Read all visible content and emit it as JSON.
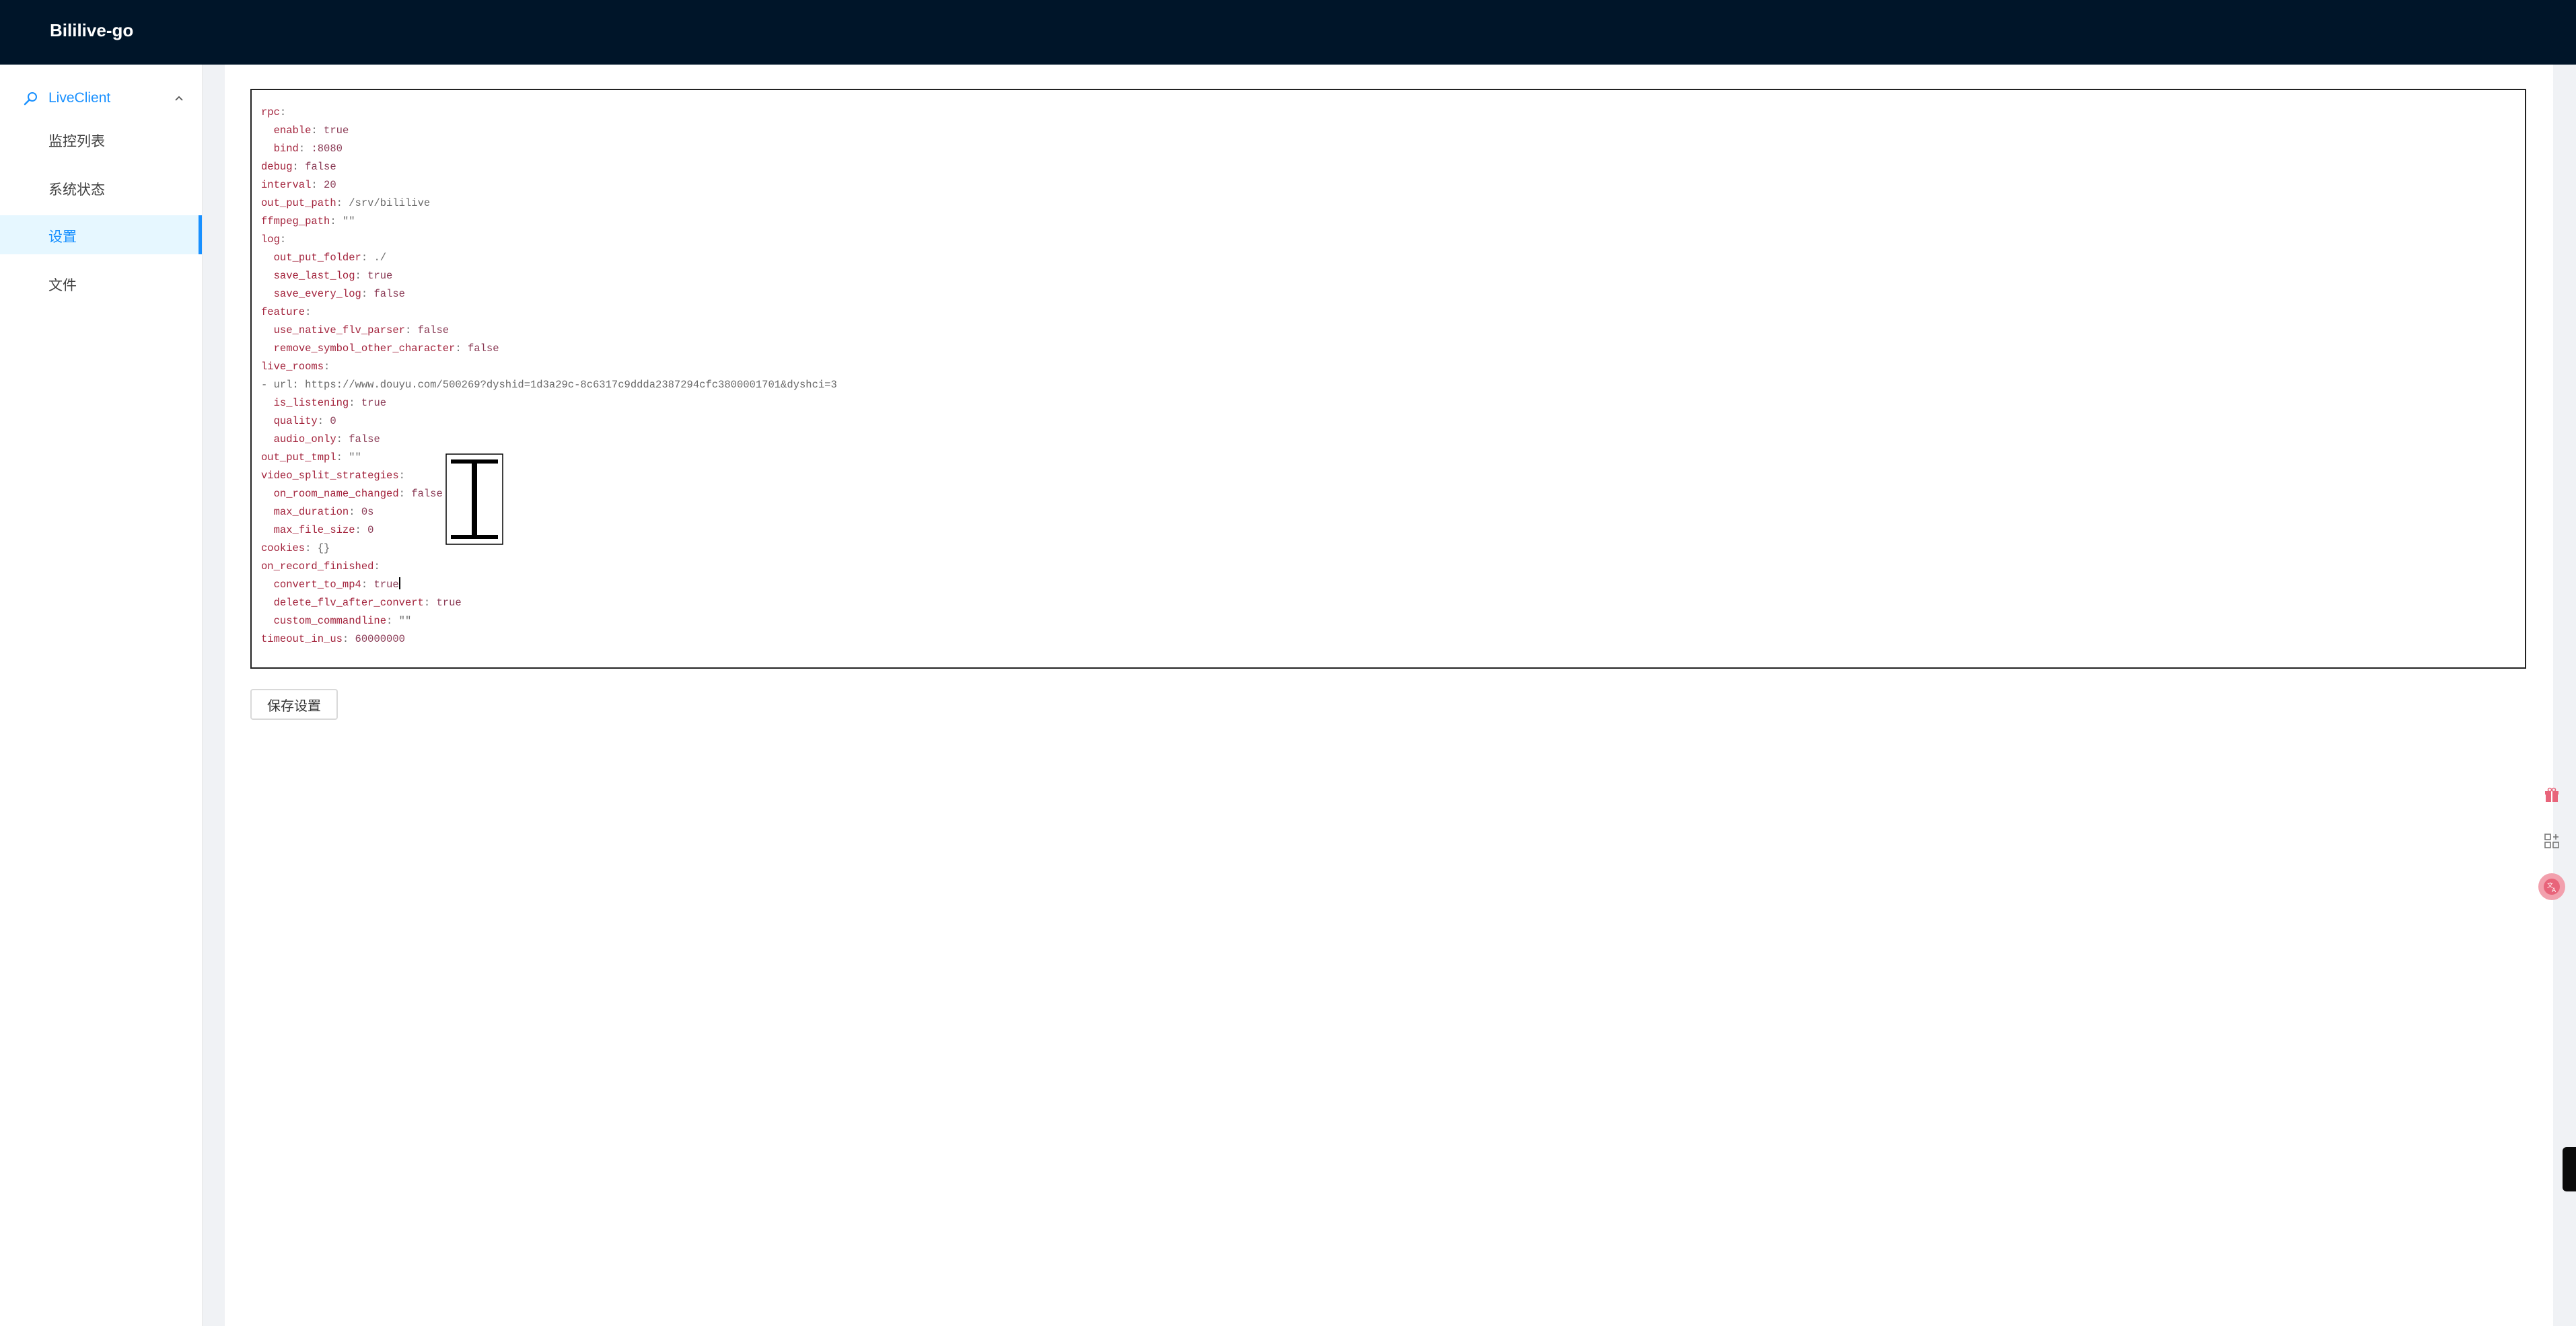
{
  "app": {
    "title": "Bililive-go"
  },
  "sidebar": {
    "group": {
      "label": "LiveClient",
      "icon": "search-icon",
      "chevron": "chevron-up-icon"
    },
    "items": [
      {
        "label": "监控列表",
        "active": false
      },
      {
        "label": "系统状态",
        "active": false
      },
      {
        "label": "设置",
        "active": true
      },
      {
        "label": "文件",
        "active": false
      }
    ]
  },
  "editor": {
    "lines": [
      {
        "indent": "",
        "key": "rpc",
        "value": "",
        "vclass": ""
      },
      {
        "indent": "  ",
        "key": "enable",
        "value": "true",
        "vclass": "v"
      },
      {
        "indent": "  ",
        "key": "bind",
        "value": ":8080",
        "vclass": "v"
      },
      {
        "indent": "",
        "key": "debug",
        "value": "false",
        "vclass": "v"
      },
      {
        "indent": "",
        "key": "interval",
        "value": "20",
        "vclass": "v"
      },
      {
        "indent": "",
        "key": "out_put_path",
        "value": "/srv/bililive",
        "vclass": "s"
      },
      {
        "indent": "",
        "key": "ffmpeg_path",
        "value": "\"\"",
        "vclass": "s"
      },
      {
        "indent": "",
        "key": "log",
        "value": "",
        "vclass": ""
      },
      {
        "indent": "  ",
        "key": "out_put_folder",
        "value": "./",
        "vclass": "s"
      },
      {
        "indent": "  ",
        "key": "save_last_log",
        "value": "true",
        "vclass": "v"
      },
      {
        "indent": "  ",
        "key": "save_every_log",
        "value": "false",
        "vclass": "v"
      },
      {
        "indent": "",
        "key": "feature",
        "value": "",
        "vclass": ""
      },
      {
        "indent": "  ",
        "key": "use_native_flv_parser",
        "value": "false",
        "vclass": "v"
      },
      {
        "indent": "  ",
        "key": "remove_symbol_other_character",
        "value": "false",
        "vclass": "v"
      },
      {
        "indent": "",
        "key": "live_rooms",
        "value": "",
        "vclass": ""
      },
      {
        "indent": "- ",
        "key": "url",
        "value": "https://www.douyu.com/500269?dyshid=1d3a29c-8c6317c9ddda2387294cfc3800001701&dyshci=3",
        "vclass": "s",
        "dash": true
      },
      {
        "indent": "  ",
        "key": "is_listening",
        "value": "true",
        "vclass": "v"
      },
      {
        "indent": "  ",
        "key": "quality",
        "value": "0",
        "vclass": "v"
      },
      {
        "indent": "  ",
        "key": "audio_only",
        "value": "false",
        "vclass": "v"
      },
      {
        "indent": "",
        "key": "out_put_tmpl",
        "value": "\"\"",
        "vclass": "s"
      },
      {
        "indent": "",
        "key": "video_split_strategies",
        "value": "",
        "vclass": ""
      },
      {
        "indent": "  ",
        "key": "on_room_name_changed",
        "value": "false",
        "vclass": "v"
      },
      {
        "indent": "  ",
        "key": "max_duration",
        "value": "0s",
        "vclass": "v"
      },
      {
        "indent": "  ",
        "key": "max_file_size",
        "value": "0",
        "vclass": "v"
      },
      {
        "indent": "",
        "key": "cookies",
        "value": "{}",
        "vclass": "s"
      },
      {
        "indent": "",
        "key": "on_record_finished",
        "value": "",
        "vclass": ""
      },
      {
        "indent": "  ",
        "key": "convert_to_mp4",
        "value": "true",
        "vclass": "v",
        "caret": true
      },
      {
        "indent": "  ",
        "key": "delete_flv_after_convert",
        "value": "true",
        "vclass": "v"
      },
      {
        "indent": "  ",
        "key": "custom_commandline",
        "value": "\"\"",
        "vclass": "s"
      },
      {
        "indent": "",
        "key": "timeout_in_us",
        "value": "60000000",
        "vclass": "v"
      }
    ]
  },
  "actions": {
    "save_label": "保存设置"
  },
  "floating": [
    {
      "name": "gift-icon",
      "color": "#e8647a"
    },
    {
      "name": "grid-add-icon",
      "color": "#8c8c8c"
    },
    {
      "name": "translate-icon",
      "color": "#e8647a"
    }
  ],
  "colors": {
    "header": "#001529",
    "accent": "#1890ff",
    "active_bg": "#e6f7ff"
  }
}
